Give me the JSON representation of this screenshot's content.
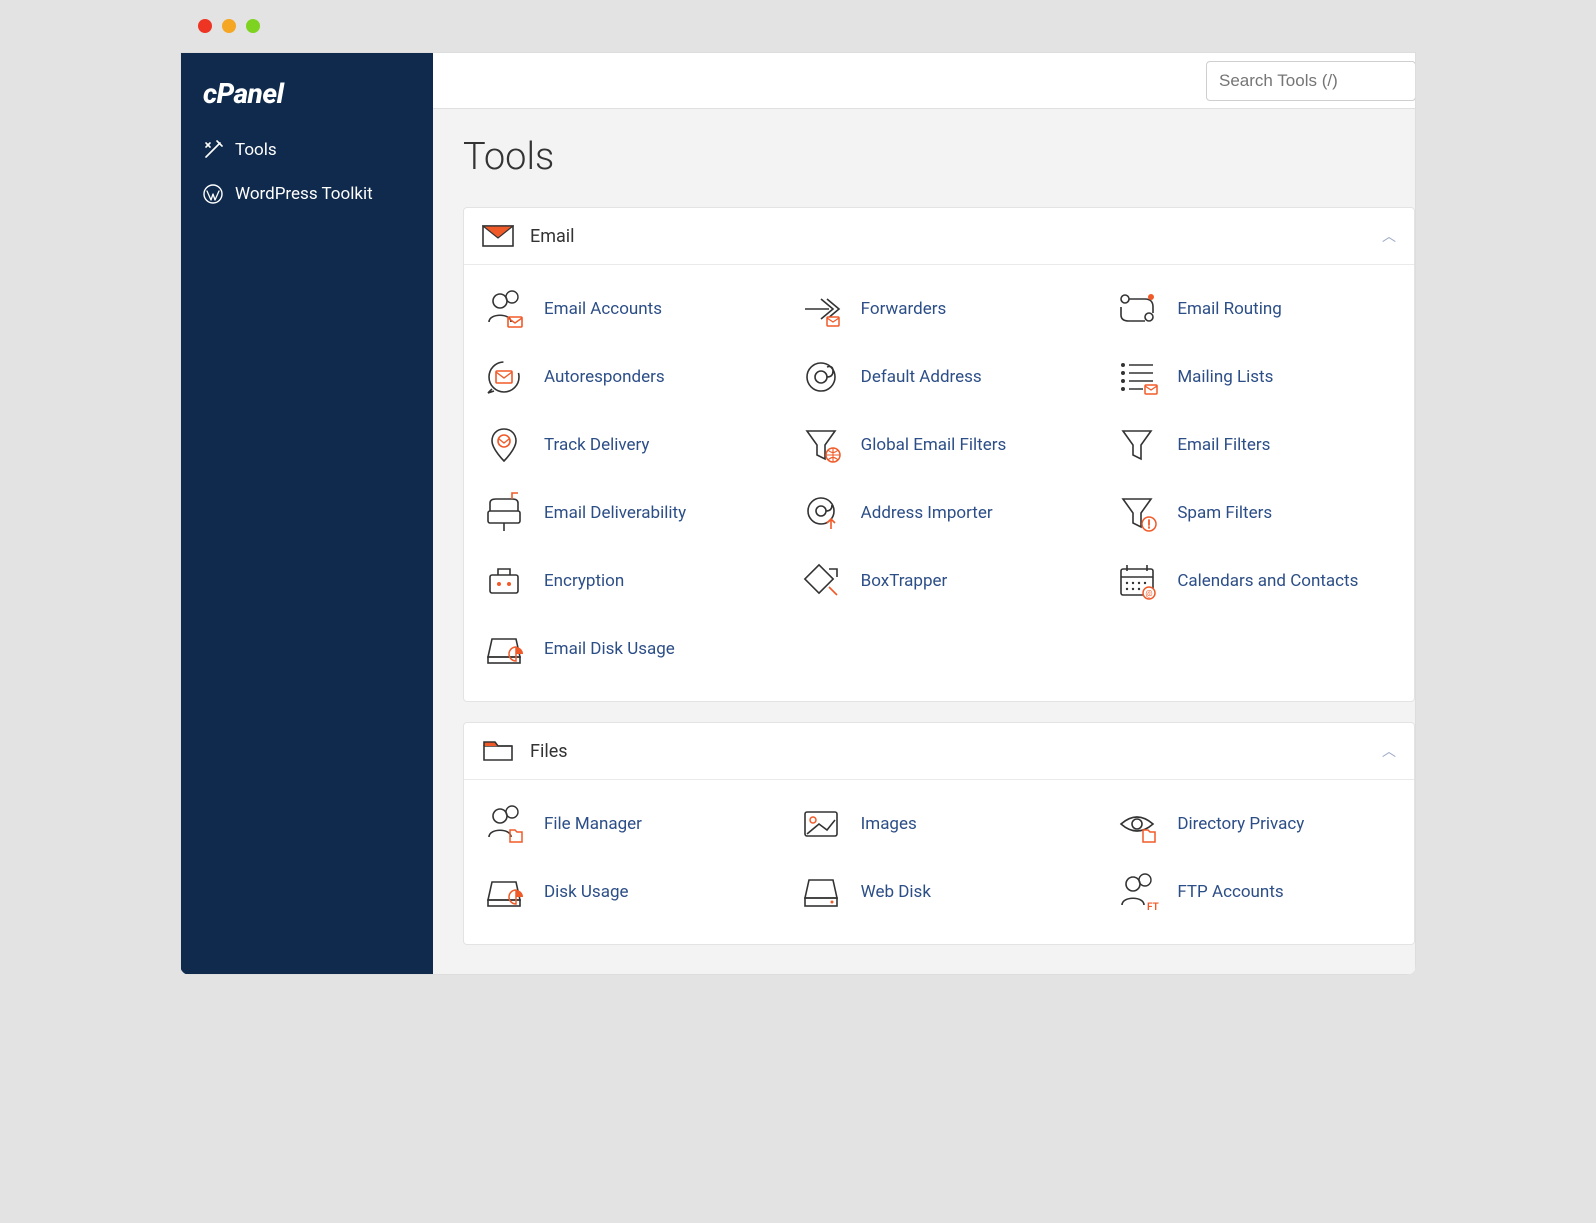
{
  "brand": "cPanel",
  "search_placeholder": "Search Tools (/)",
  "page_title": "Tools",
  "nav": [
    {
      "id": "tools",
      "label": "Tools",
      "icon": "tools"
    },
    {
      "id": "wp",
      "label": "WordPress Toolkit",
      "icon": "wordpress"
    }
  ],
  "sections": [
    {
      "id": "email",
      "title": "Email",
      "icon": "envelope",
      "collapsed": false,
      "items": [
        {
          "id": "email-accounts",
          "label": "Email Accounts",
          "icon": "user-mail"
        },
        {
          "id": "forwarders",
          "label": "Forwarders",
          "icon": "forward"
        },
        {
          "id": "email-routing",
          "label": "Email Routing",
          "icon": "routing"
        },
        {
          "id": "autoresponders",
          "label": "Autoresponders",
          "icon": "autoresponder"
        },
        {
          "id": "default-address",
          "label": "Default Address",
          "icon": "at"
        },
        {
          "id": "mailing-lists",
          "label": "Mailing Lists",
          "icon": "list-mail"
        },
        {
          "id": "track-delivery",
          "label": "Track Delivery",
          "icon": "pin-mail"
        },
        {
          "id": "global-email-filters",
          "label": "Global Email Filters",
          "icon": "funnel-globe"
        },
        {
          "id": "email-filters",
          "label": "Email Filters",
          "icon": "funnel"
        },
        {
          "id": "email-deliverability",
          "label": "Email Deliverability",
          "icon": "mailbox"
        },
        {
          "id": "address-importer",
          "label": "Address Importer",
          "icon": "at-up"
        },
        {
          "id": "spam-filters",
          "label": "Spam Filters",
          "icon": "funnel-alert"
        },
        {
          "id": "encryption",
          "label": "Encryption",
          "icon": "briefcase"
        },
        {
          "id": "box-trapper",
          "label": "BoxTrapper",
          "icon": "boxtrap"
        },
        {
          "id": "calendars-contacts",
          "label": "Calendars and Contacts",
          "icon": "calendar"
        },
        {
          "id": "email-disk-usage",
          "label": "Email Disk Usage",
          "icon": "disk-pie"
        }
      ]
    },
    {
      "id": "files",
      "title": "Files",
      "icon": "folder",
      "collapsed": false,
      "items": [
        {
          "id": "file-manager",
          "label": "File Manager",
          "icon": "user-folder"
        },
        {
          "id": "images",
          "label": "Images",
          "icon": "image"
        },
        {
          "id": "directory-privacy",
          "label": "Directory Privacy",
          "icon": "eye-folder"
        },
        {
          "id": "disk-usage",
          "label": "Disk Usage",
          "icon": "disk-pie"
        },
        {
          "id": "web-disk",
          "label": "Web Disk",
          "icon": "disk"
        },
        {
          "id": "ftp-accounts",
          "label": "FTP Accounts",
          "icon": "user-ftp"
        }
      ]
    }
  ]
}
